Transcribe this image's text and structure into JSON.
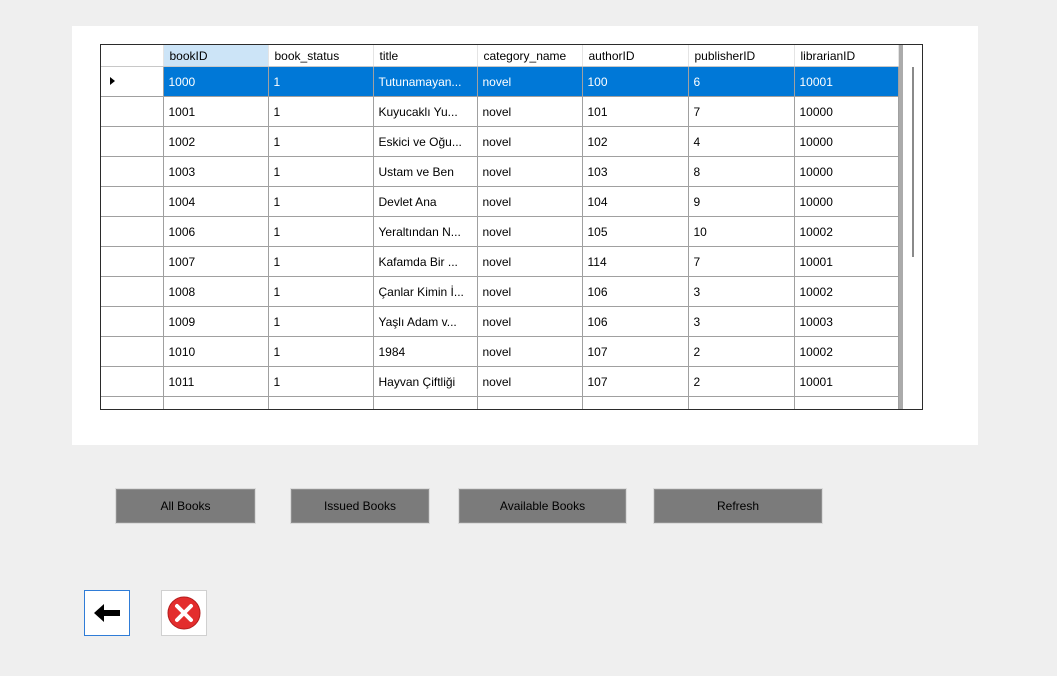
{
  "grid": {
    "columns": [
      "bookID",
      "book_status",
      "title",
      "category_name",
      "authorID",
      "publisherID",
      "librarianID"
    ],
    "rows": [
      [
        "1000",
        "1",
        "Tutunamayan...",
        "novel",
        "100",
        "6",
        "10001"
      ],
      [
        "1001",
        "1",
        "Kuyucaklı Yu...",
        "novel",
        "101",
        "7",
        "10000"
      ],
      [
        "1002",
        "1",
        "Eskici ve Oğu...",
        "novel",
        "102",
        "4",
        "10000"
      ],
      [
        "1003",
        "1",
        "Ustam ve Ben",
        "novel",
        "103",
        "8",
        "10000"
      ],
      [
        "1004",
        "1",
        "Devlet Ana",
        "novel",
        "104",
        "9",
        "10000"
      ],
      [
        "1006",
        "1",
        "Yeraltından N...",
        "novel",
        "105",
        "10",
        "10002"
      ],
      [
        "1007",
        "1",
        "Kafamda Bir ...",
        "novel",
        "114",
        "7",
        "10001"
      ],
      [
        "1008",
        "1",
        "Çanlar Kimin İ...",
        "novel",
        "106",
        "3",
        "10002"
      ],
      [
        "1009",
        "1",
        "Yaşlı Adam v...",
        "novel",
        "106",
        "3",
        "10003"
      ],
      [
        "1010",
        "1",
        "1984",
        "novel",
        "107",
        "2",
        "10002"
      ],
      [
        "1011",
        "1",
        "Hayvan Çiftliği",
        "novel",
        "107",
        "2",
        "10001"
      ],
      [
        "",
        "",
        "",
        "",
        "",
        "",
        ""
      ]
    ],
    "selected_row": 0
  },
  "buttons": {
    "all_books": "All Books",
    "issued_books": "Issued Books",
    "available_books": "Available Books",
    "refresh": "Refresh"
  },
  "icons": {
    "back": "back-arrow-icon",
    "close": "close-icon"
  },
  "colors": {
    "selection": "#0078d7",
    "sorted_header": "#cce4f7",
    "button_bg": "#7b7b7b",
    "close_red": "#e32d2d"
  }
}
